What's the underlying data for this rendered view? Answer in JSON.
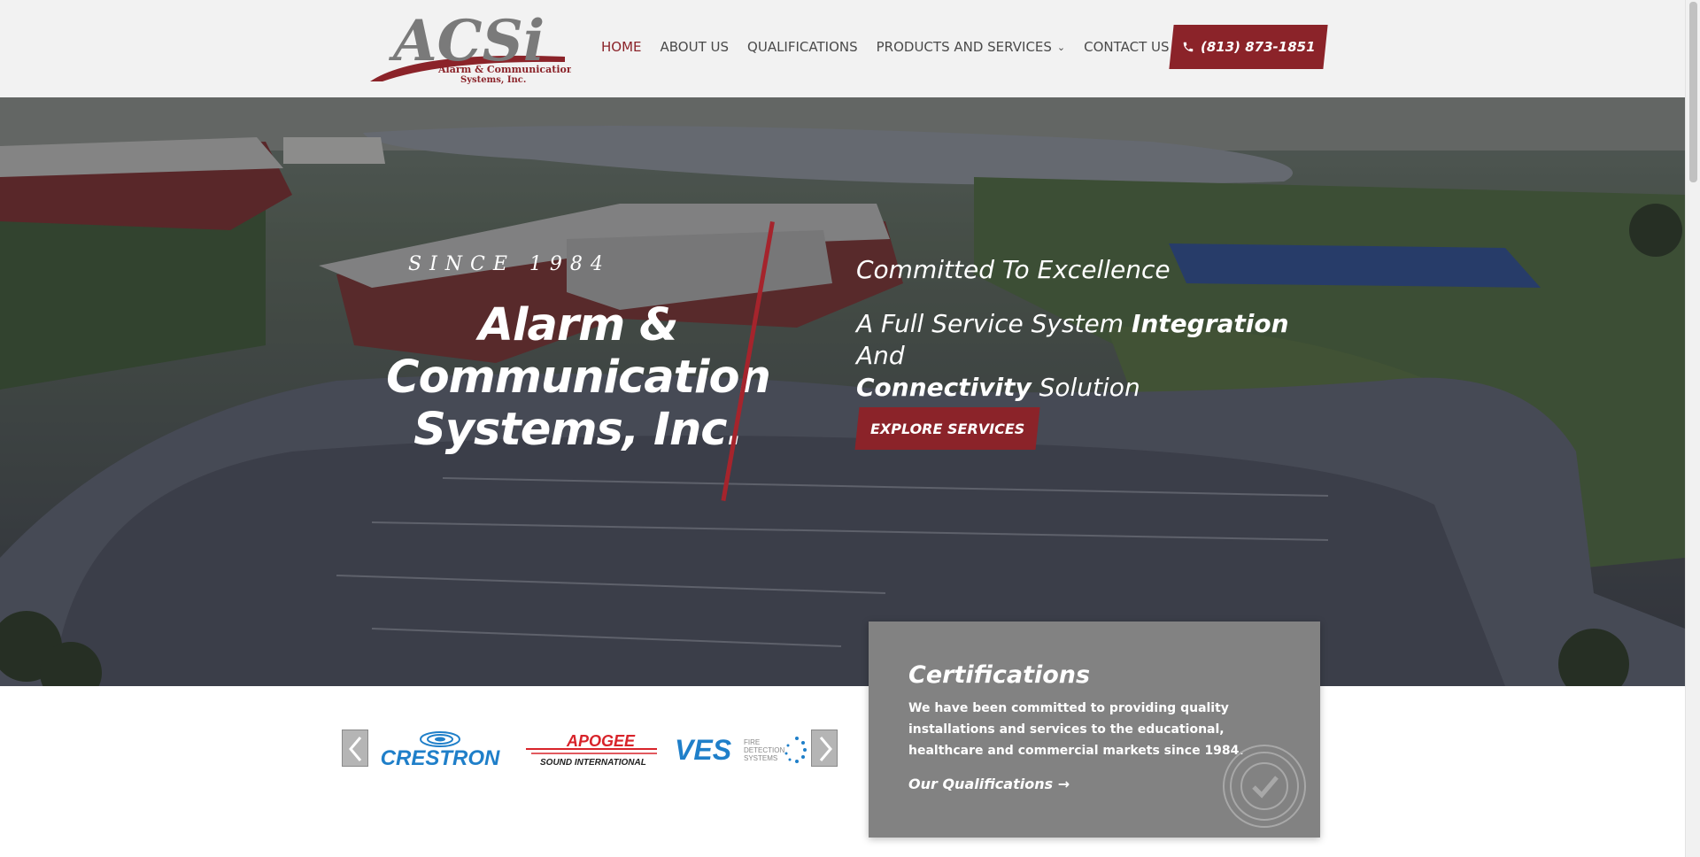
{
  "header": {
    "logo": {
      "main": "ACSi",
      "sub1": "Alarm & Communication",
      "sub2": "Systems, Inc."
    },
    "nav": [
      {
        "label": "HOME",
        "active": true
      },
      {
        "label": "ABOUT US"
      },
      {
        "label": "QUALIFICATIONS"
      },
      {
        "label": "PRODUCTS AND SERVICES",
        "has_dropdown": true
      },
      {
        "label": "CONTACT US"
      }
    ],
    "phone": "(813) 873-1851",
    "phone_icon": "phone-icon"
  },
  "hero": {
    "since": "SINCE 1984",
    "company_name": "Alarm & Communication Systems, Inc.",
    "tagline_heading": "Committed To Excellence",
    "tagline_parts": {
      "a": "A Full Service System ",
      "b": "Integration",
      "c": " And ",
      "d": "Connectivity",
      "e": " Solution"
    },
    "cta": "EXPLORE SERVICES"
  },
  "partners": {
    "brands": [
      {
        "name": "CRESTRON"
      },
      {
        "name": "APOGEE",
        "sub": "SOUND INTERNATIONAL"
      },
      {
        "name": "VES",
        "sub1": "FIRE",
        "sub2": "DETECTION",
        "sub3": "SYSTEMS"
      }
    ],
    "prev_icon": "chevron-left-icon",
    "next_icon": "chevron-right-icon"
  },
  "certifications": {
    "title": "Certifications",
    "body": "We have been committed to providing quality installations and services to the educational, healthcare and commercial markets since 1984.",
    "link": "Our Qualifications →",
    "badge_icon": "check-badge-icon"
  },
  "colors": {
    "brand_red": "#8b2329",
    "header_bg": "#f2f2f2",
    "card_bg": "#828282",
    "nav_text": "#4a4a4a"
  }
}
